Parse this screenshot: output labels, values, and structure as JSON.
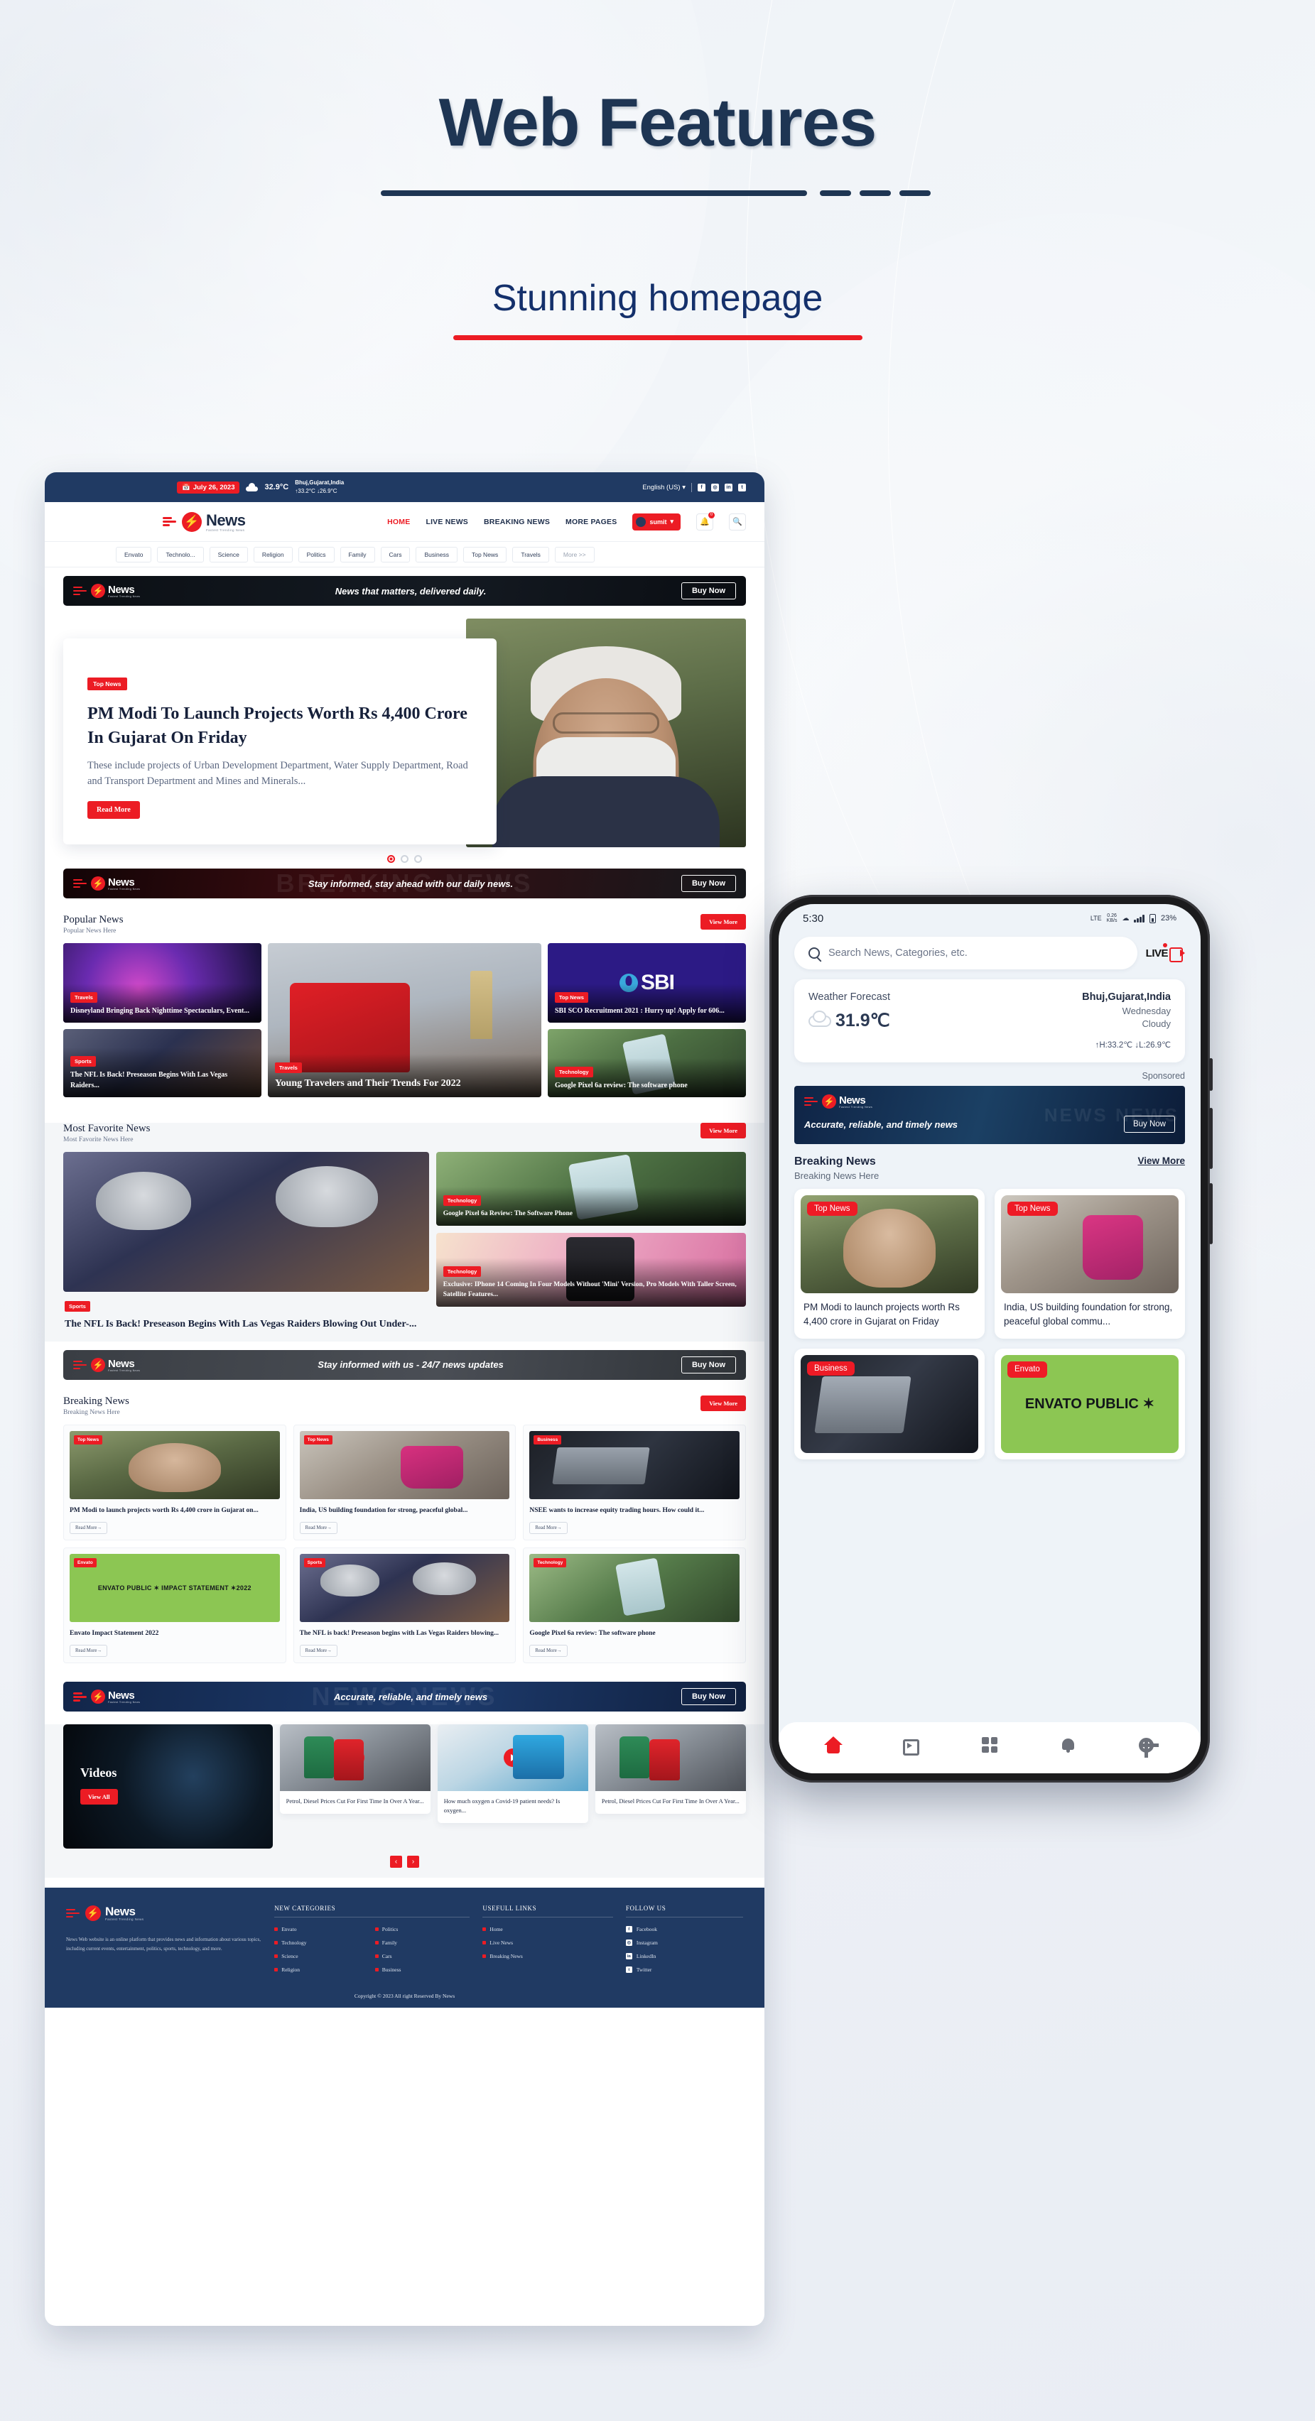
{
  "hero": {
    "title": "Web Features",
    "subtitle": "Stunning homepage"
  },
  "web": {
    "topbar": {
      "date": "July 26, 2023",
      "temp": "32.9°C",
      "city": "Bhuj,Gujarat,India",
      "hi_lo": "↑33.2°C ↓26.9°C",
      "language": "English (US)",
      "socials": [
        "f",
        "◎",
        "in",
        "t"
      ]
    },
    "brand": {
      "name": "News",
      "tagline": "Fastest Trending News"
    },
    "nav": [
      "HOME",
      "LIVE NEWS",
      "BREAKING NEWS",
      "MORE PAGES"
    ],
    "user_name": "sumit",
    "notification_count": "0",
    "categories": [
      "Envato",
      "Technolo...",
      "Science",
      "Religion",
      "Politics",
      "Family",
      "Cars",
      "Business",
      "Top News",
      "Travels",
      "More >>"
    ],
    "ads": [
      {
        "slogan": "News that matters, delivered daily.",
        "cta": "Buy Now"
      },
      {
        "slogan": "Stay informed, stay ahead with our daily news.",
        "cta": "Buy Now",
        "ghost": "BREAKING NEWS"
      },
      {
        "slogan": "Stay informed with us - 24/7 news updates",
        "cta": "Buy Now"
      },
      {
        "slogan": "Accurate, reliable, and timely news",
        "cta": "Buy Now",
        "ghost": "NEWS NEWS"
      }
    ],
    "hero_slide": {
      "tag": "Top News",
      "title": "PM Modi To Launch Projects Worth Rs 4,400 Crore In Gujarat On Friday",
      "excerpt": "These include projects of Urban Development Department, Water Supply Department, Road and Transport Department and Mines and Minerals...",
      "cta": "Read More"
    },
    "popular": {
      "title": "Popular News",
      "subtitle": "Popular News Here",
      "view_more": "View More",
      "cards": [
        {
          "tag": "Travels",
          "title": "Disneyland Bringing Back Nighttime Spectaculars, Event..."
        },
        {
          "tag": "Sports",
          "title": "The NFL Is Back! Preseason Begins With Las Vegas Raiders..."
        },
        {
          "tag": "Travels",
          "title": "Young Travelers and Their Trends For 2022"
        },
        {
          "tag": "Top News",
          "title": "SBI SCO Recruitment 2021 : Hurry up! Apply for 606..."
        },
        {
          "tag": "Technology",
          "title": "Google Pixel 6a review: The software phone"
        }
      ]
    },
    "favorite": {
      "title": "Most Favorite News",
      "subtitle": "Most Favorite News Here",
      "view_more": "View More",
      "main": {
        "tag": "Sports",
        "title": "The NFL Is Back! Preseason Begins With Las Vegas Raiders Blowing Out Under-..."
      },
      "side": [
        {
          "tag": "Technology",
          "title": "Google Pixel 6a Review: The Software Phone"
        },
        {
          "tag": "Technology",
          "title": "Exclusive: IPhone 14 Coming In Four Models Without 'Mini' Version, Pro Models With Taller Screen, Satellite Features..."
        }
      ]
    },
    "breaking": {
      "title": "Breaking News",
      "subtitle": "Breaking News Here",
      "view_more": "View More",
      "read_more": "Read More→",
      "cards": [
        {
          "tag": "Top News",
          "title": "PM Modi to launch projects worth Rs 4,400 crore in Gujarat on..."
        },
        {
          "tag": "Top News",
          "title": "India, US building foundation for strong, peaceful global..."
        },
        {
          "tag": "Business",
          "title": "NSEE wants to increase equity trading hours. How could it..."
        },
        {
          "tag": "Envato",
          "title": "Envato Impact Statement 2022",
          "thumb_text": "ENVATO PUBLIC ✶ IMPACT STATEMENT ✶2022"
        },
        {
          "tag": "Sports",
          "title": "The NFL is back! Preseason begins with Las Vegas Raiders blowing..."
        },
        {
          "tag": "Technology",
          "title": "Google Pixel 6a review: The software phone"
        }
      ]
    },
    "videos": {
      "title": "Videos",
      "view_all": "View All",
      "items": [
        {
          "caption": "Petrol, Diesel Prices Cut For First Time In Over A Year..."
        },
        {
          "caption": "How much oxygen a Covid-19 patient needs? Is oxygen..."
        },
        {
          "caption": "Petrol, Diesel Prices Cut For First Time In Over A Year..."
        }
      ],
      "prev": "‹",
      "next": "›"
    },
    "footer": {
      "description": "News Web website is an online platform that provides news and information about various topics, including current events, entertainment, politics, sports, technology, and more.",
      "col1_title": "NEW CATEGORIES",
      "col1_links": [
        "Envato",
        "Politics",
        "Technology",
        "Family",
        "Science",
        "Cars",
        "Religion",
        "Business"
      ],
      "col2_title": "USEFULL LINKS",
      "col2_links": [
        "Home",
        "Live News",
        "Breaking News"
      ],
      "col3_title": "FOLLOW US",
      "col3_links": [
        {
          "icon": "f",
          "label": "Facebook"
        },
        {
          "icon": "◎",
          "label": "Instagram"
        },
        {
          "icon": "in",
          "label": "LinkedIn"
        },
        {
          "icon": "t",
          "label": "Twitter"
        }
      ],
      "copyright": "Copyright © 2023 All right Reserved By News"
    }
  },
  "phone": {
    "status": {
      "time": "5:30",
      "network": "LTE",
      "speed_value": "0.26",
      "speed_unit": "KB/s",
      "battery": "23%"
    },
    "search_placeholder": "Search News, Categories, etc.",
    "live_label": "LIVE",
    "weather": {
      "title": "Weather Forecast",
      "temp": "31.9℃",
      "location": "Bhuj,Gujarat,India",
      "day": "Wednesday",
      "condition": "Cloudy",
      "high_low": "↑H:33.2℃  ↓L:26.9℃"
    },
    "sponsored_label": "Sponsored",
    "ad": {
      "slogan": "Accurate, reliable, and timely news",
      "cta": "Buy Now",
      "brand": "News",
      "tagline": "Fastest Trending News"
    },
    "breaking": {
      "title": "Breaking News",
      "subtitle": "Breaking News Here",
      "view_more": "View More",
      "cards": [
        {
          "tag": "Top News",
          "title": "PM Modi to launch projects worth Rs 4,400 crore in Gujarat on Friday"
        },
        {
          "tag": "Top News",
          "title": "India, US building foundation for strong, peaceful global commu..."
        },
        {
          "tag": "Business",
          "title": ""
        },
        {
          "tag": "Envato",
          "title": "",
          "thumb_text": "ENVATO PUBLIC ✶"
        }
      ]
    },
    "bottom_nav": [
      "home-icon",
      "video-library-icon",
      "grid-icon",
      "bell-icon",
      "gear-icon"
    ]
  },
  "colors": {
    "accent": "#ec1c24",
    "navy": "#203a63",
    "dark_text": "#16203a"
  }
}
